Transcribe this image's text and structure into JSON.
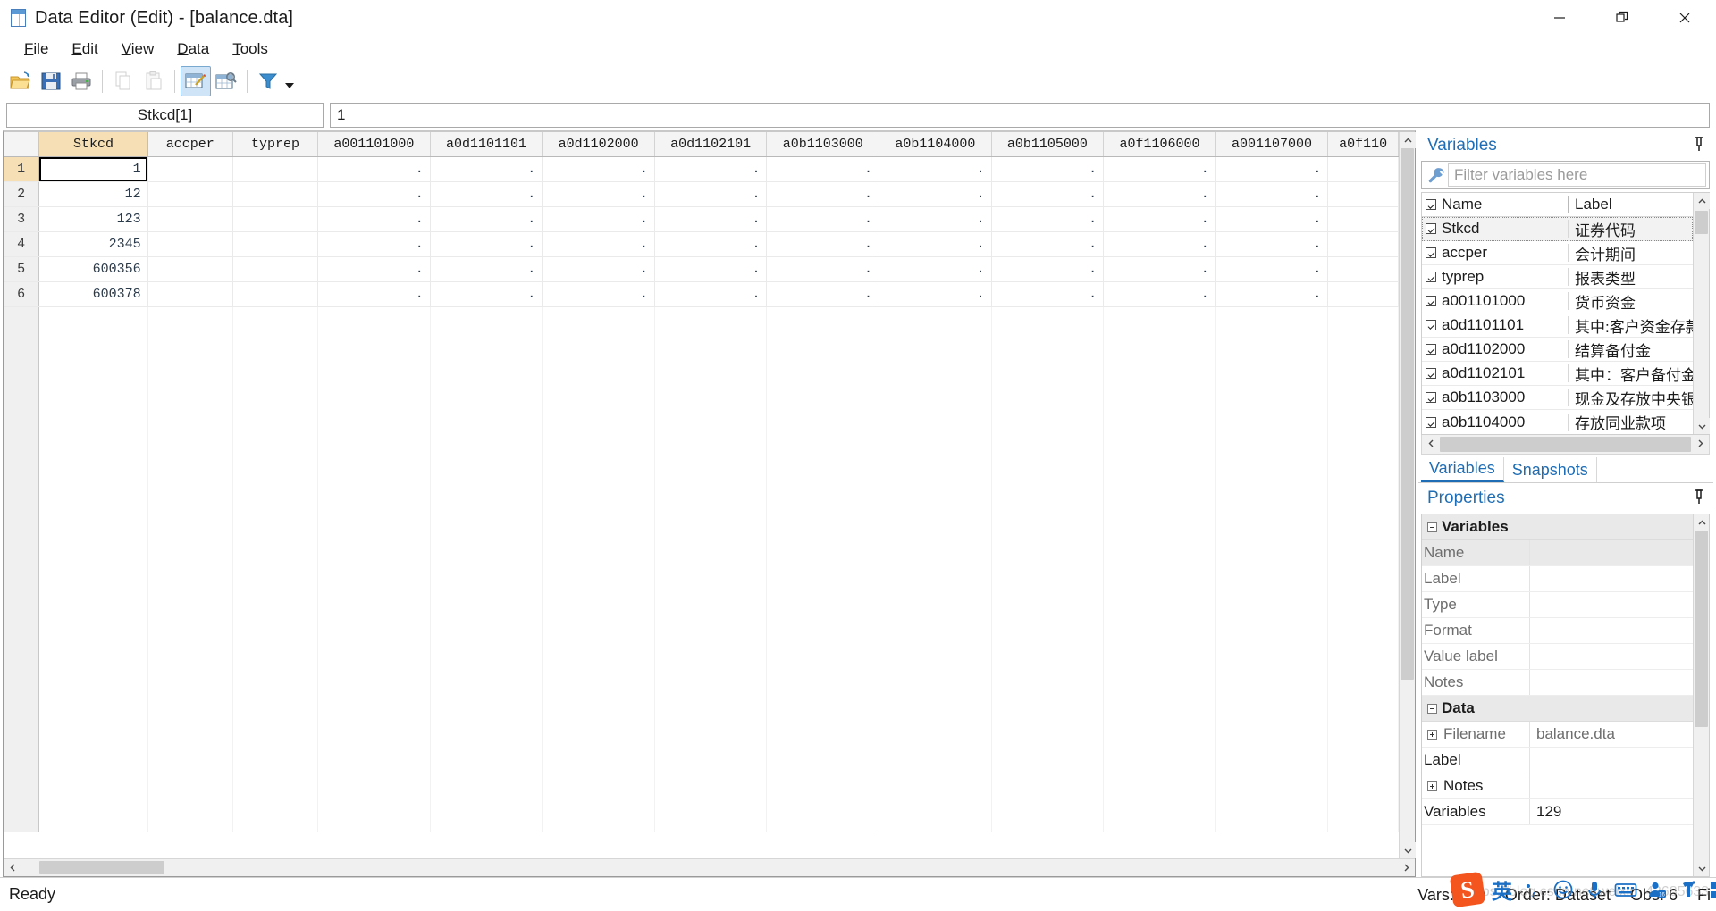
{
  "window": {
    "title": "Data Editor (Edit) - [balance.dta]",
    "app_icon": "stata-data-editor-icon",
    "minimize": "—",
    "maximize": "❐",
    "close": "✕"
  },
  "menubar": {
    "items": [
      {
        "label": "File",
        "mnemonic": "F"
      },
      {
        "label": "Edit",
        "mnemonic": "E"
      },
      {
        "label": "View",
        "mnemonic": "V"
      },
      {
        "label": "Data",
        "mnemonic": "D"
      },
      {
        "label": "Tools",
        "mnemonic": "T"
      }
    ]
  },
  "toolbar": {
    "buttons": [
      {
        "name": "open-icon",
        "title": "Open"
      },
      {
        "name": "save-icon",
        "title": "Save"
      },
      {
        "name": "print-icon",
        "title": "Print"
      },
      {
        "name": "copy-icon",
        "title": "Copy"
      },
      {
        "name": "paste-icon",
        "title": "Paste"
      },
      {
        "name": "data-editor-edit-icon",
        "title": "Data Editor (Edit)"
      },
      {
        "name": "data-editor-browse-icon",
        "title": "Data Editor (Browse)"
      },
      {
        "name": "filter-icon",
        "title": "Filter"
      }
    ]
  },
  "cell_reference": {
    "name": "Stkcd[1]",
    "value": "1"
  },
  "grid": {
    "columns": [
      "Stkcd",
      "accper",
      "typrep",
      "a001101000",
      "a0d1101101",
      "a0d1102000",
      "a0d1102101",
      "a0b1103000",
      "a0b1104000",
      "a0b1105000",
      "a0f1106000",
      "a001107000",
      "a0f110"
    ],
    "selected_column": "Stkcd",
    "active_cell": {
      "row": 1,
      "column": "Stkcd"
    },
    "rows": [
      {
        "num": "1",
        "cells": [
          "1",
          "",
          "",
          ".",
          ".",
          ".",
          ".",
          ".",
          ".",
          ".",
          ".",
          ".",
          ""
        ]
      },
      {
        "num": "2",
        "cells": [
          "12",
          "",
          "",
          ".",
          ".",
          ".",
          ".",
          ".",
          ".",
          ".",
          ".",
          ".",
          ""
        ]
      },
      {
        "num": "3",
        "cells": [
          "123",
          "",
          "",
          ".",
          ".",
          ".",
          ".",
          ".",
          ".",
          ".",
          ".",
          ".",
          ""
        ]
      },
      {
        "num": "4",
        "cells": [
          "2345",
          "",
          "",
          ".",
          ".",
          ".",
          ".",
          ".",
          ".",
          ".",
          ".",
          ".",
          ""
        ]
      },
      {
        "num": "5",
        "cells": [
          "600356",
          "",
          "",
          ".",
          ".",
          ".",
          ".",
          ".",
          ".",
          ".",
          ".",
          ".",
          ""
        ]
      },
      {
        "num": "6",
        "cells": [
          "600378",
          "",
          "",
          ".",
          ".",
          ".",
          ".",
          ".",
          ".",
          ".",
          ".",
          ".",
          ""
        ]
      }
    ]
  },
  "variables_panel": {
    "title": "Variables",
    "pin_icon": "pin-icon",
    "filter_icon": "wrench-icon",
    "filter_placeholder": "Filter variables here",
    "filter_value": "",
    "headers": {
      "name": "Name",
      "label": "Label"
    },
    "rows": [
      {
        "name": "Stkcd",
        "label": "证券代码",
        "checked": true,
        "selected": true
      },
      {
        "name": "accper",
        "label": "会计期间",
        "checked": true,
        "selected": false
      },
      {
        "name": "typrep",
        "label": "报表类型",
        "checked": true,
        "selected": false
      },
      {
        "name": "a001101000",
        "label": "货币资金",
        "checked": true,
        "selected": false
      },
      {
        "name": "a0d1101101",
        "label": "其中:客户资金存款",
        "checked": true,
        "selected": false
      },
      {
        "name": "a0d1102000",
        "label": "结算备付金",
        "checked": true,
        "selected": false
      },
      {
        "name": "a0d1102101",
        "label": "其中：客户备付金",
        "checked": true,
        "selected": false
      },
      {
        "name": "a0b1103000",
        "label": "现金及存放中央银..",
        "checked": true,
        "selected": false
      },
      {
        "name": "a0b1104000",
        "label": "存放同业款项",
        "checked": true,
        "selected": false
      }
    ],
    "tabs": [
      {
        "label": "Variables",
        "active": true
      },
      {
        "label": "Snapshots",
        "active": false
      }
    ]
  },
  "properties_panel": {
    "title": "Properties",
    "pin_icon": "pin-icon",
    "groups": [
      {
        "name": "Variables",
        "expanded": true,
        "rows": [
          {
            "key": "Name",
            "value": "",
            "shaded": true,
            "expandable": false
          },
          {
            "key": "Label",
            "value": "",
            "shaded": false,
            "expandable": false
          },
          {
            "key": "Type",
            "value": "",
            "shaded": false,
            "expandable": false
          },
          {
            "key": "Format",
            "value": "",
            "shaded": false,
            "expandable": false
          },
          {
            "key": "Value label",
            "value": "",
            "shaded": false,
            "expandable": false
          },
          {
            "key": "Notes",
            "value": "",
            "shaded": false,
            "expandable": false
          }
        ]
      },
      {
        "name": "Data",
        "expanded": true,
        "rows": [
          {
            "key": "Filename",
            "value": "balance.dta",
            "shaded": false,
            "expandable": true
          },
          {
            "key": "Label",
            "value": "",
            "shaded": false,
            "expandable": false
          },
          {
            "key": "Notes",
            "value": "",
            "shaded": false,
            "expandable": true
          },
          {
            "key": "Variables",
            "value": "129",
            "shaded": false,
            "expandable": false
          }
        ]
      }
    ]
  },
  "statusbar": {
    "left": "Ready",
    "vars": "Vars: 129",
    "order": "Order: Dataset",
    "obs": "Obs: 6",
    "filter": "Fi"
  },
  "ime": {
    "logo": "S",
    "mode": "英",
    "icons": [
      {
        "name": "punctuation-icon",
        "glyph": "˙,"
      },
      {
        "name": "emoji-icon",
        "glyph": "☺"
      },
      {
        "name": "voice-input-icon",
        "glyph": "⬤"
      },
      {
        "name": "soft-keyboard-icon",
        "glyph": "⌨"
      },
      {
        "name": "user-center-icon",
        "glyph": "⛭"
      },
      {
        "name": "skin-icon",
        "glyph": "☂"
      },
      {
        "name": "toolbox-icon",
        "glyph": "⊞"
      }
    ],
    "watermark": "https://blog.csdn.net/weixin_43685633"
  },
  "colors": {
    "accent": "#1f6eb5",
    "selected_header": "#f6dfb4",
    "grid_header": "#f4f4f4",
    "ime_orange": "#f4551e"
  }
}
